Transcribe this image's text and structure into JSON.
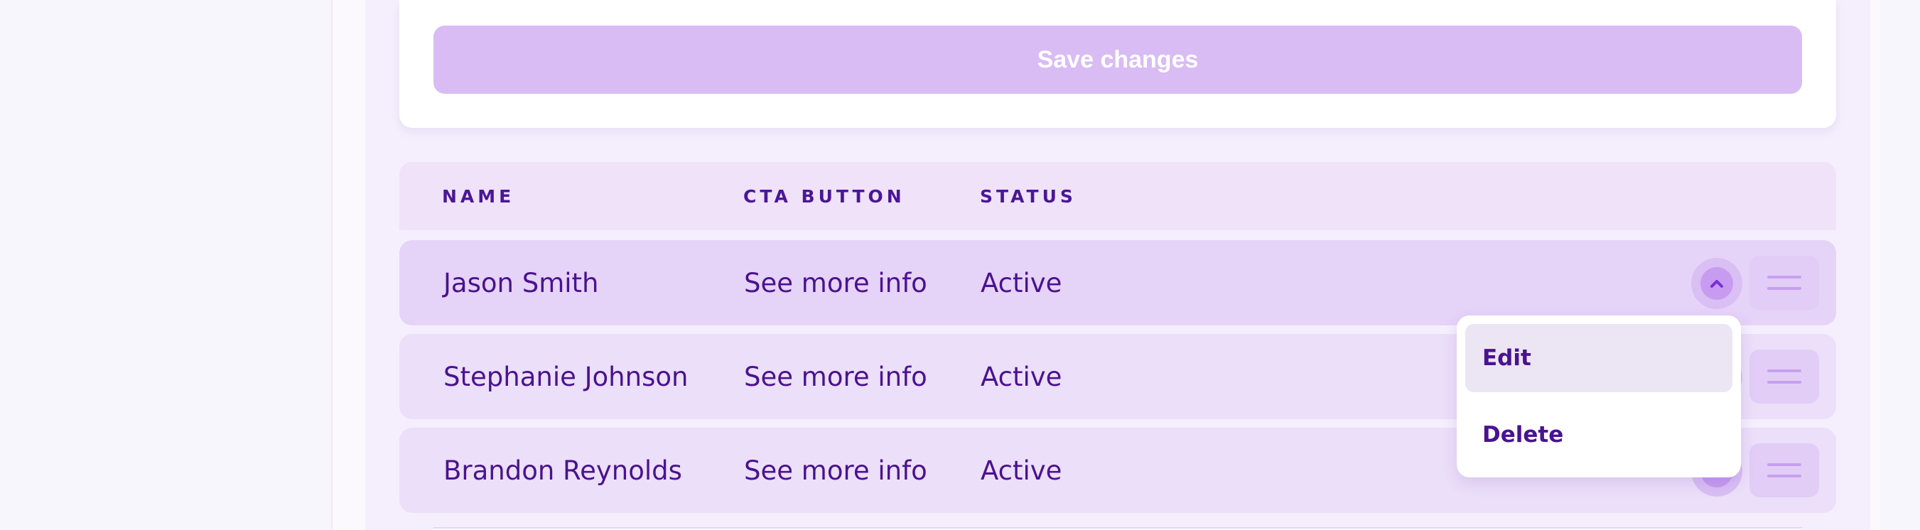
{
  "form": {
    "save_label": "Save changes"
  },
  "table": {
    "columns": [
      "NAME",
      "CTA BUTTON",
      "STATUS"
    ],
    "rows": [
      {
        "name": "Jason Smith",
        "cta": "See more info",
        "status": "Active",
        "toggle_icon": "chevron-up-icon",
        "expanded": true
      },
      {
        "name": "Stephanie Johnson",
        "cta": "See more info",
        "status": "Active"
      },
      {
        "name": "Brandon Reynolds",
        "cta": "See more info",
        "status": "Active"
      }
    ]
  },
  "row_menu": {
    "items": [
      "Edit",
      "Delete"
    ]
  },
  "colors": {
    "accent_text": "#4a1290",
    "save_button_bg": "#d9bcf3",
    "row_bg": "#ecdff9",
    "row_active_bg": "#e6d3f8"
  }
}
